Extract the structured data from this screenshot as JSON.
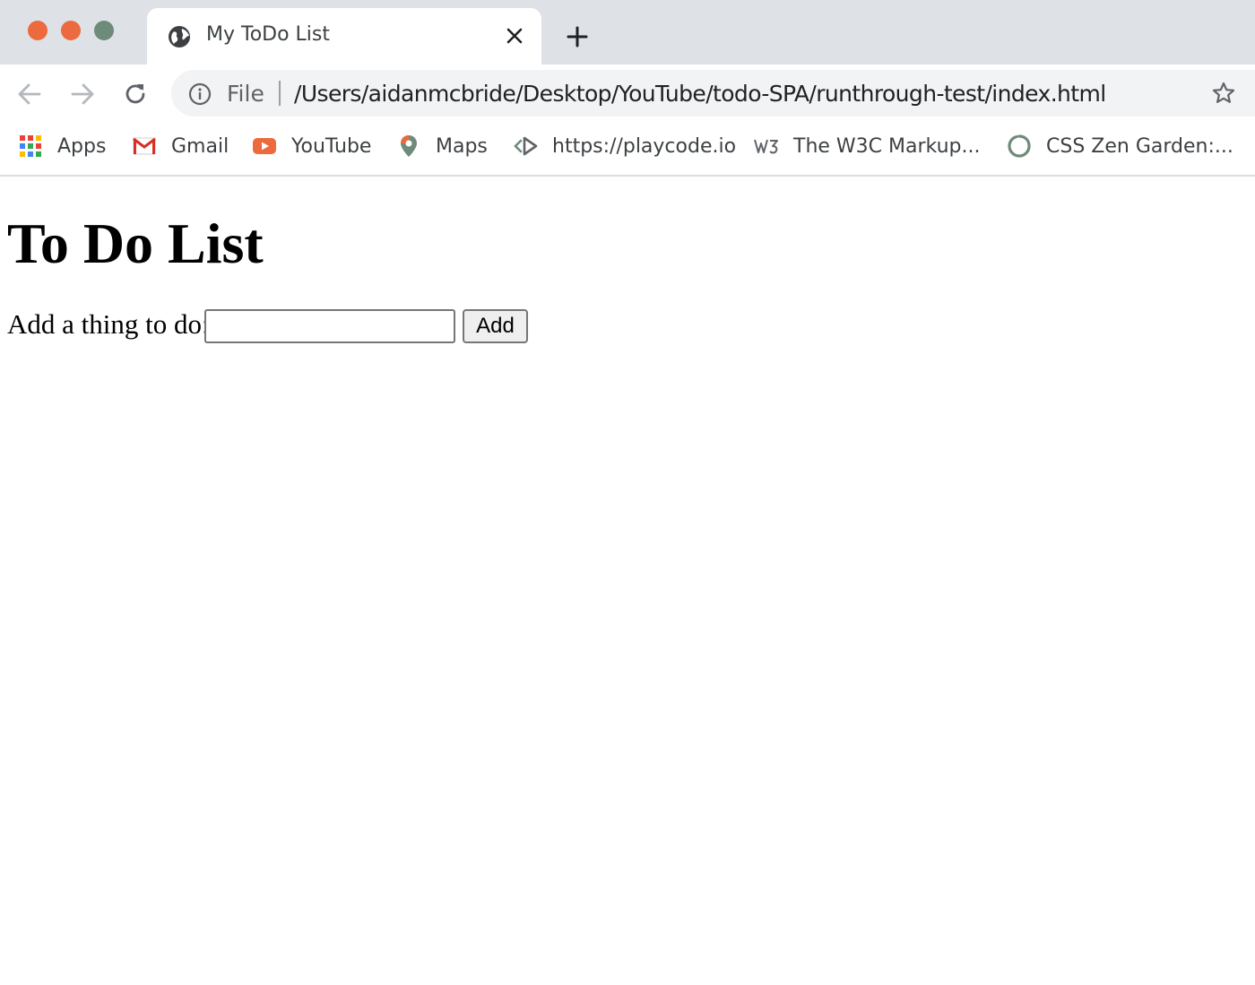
{
  "window": {
    "controls": [
      "close",
      "minimize",
      "zoom"
    ]
  },
  "tab": {
    "title": "My ToDo List",
    "icon": "globe-icon"
  },
  "toolbar": {
    "scheme_label": "File",
    "url": "/Users/aidanmcbride/Desktop/YouTube/todo-SPA/runthrough-test/index.html"
  },
  "bookmarks": [
    {
      "label": "Apps",
      "icon": "apps-grid-icon"
    },
    {
      "label": "Gmail",
      "icon": "gmail-icon"
    },
    {
      "label": "YouTube",
      "icon": "youtube-icon"
    },
    {
      "label": "Maps",
      "icon": "maps-pin-icon"
    },
    {
      "label": "https://playcode.io",
      "icon": "playcode-icon"
    },
    {
      "label": "The W3C Markup...",
      "icon": "w3c-icon"
    },
    {
      "label": "CSS Zen Garden:...",
      "icon": "zen-garden-icon"
    }
  ],
  "page": {
    "title": "To Do List",
    "input_label": "Add a thing to do:",
    "input_value": "",
    "add_button_label": "Add"
  },
  "colors": {
    "tab_strip": "#dee1e6",
    "traffic_close": "#ec6a3d",
    "traffic_minimize": "#ec6a3d",
    "traffic_zoom": "#6e8b7a",
    "omnibox": "#f1f3f4"
  }
}
